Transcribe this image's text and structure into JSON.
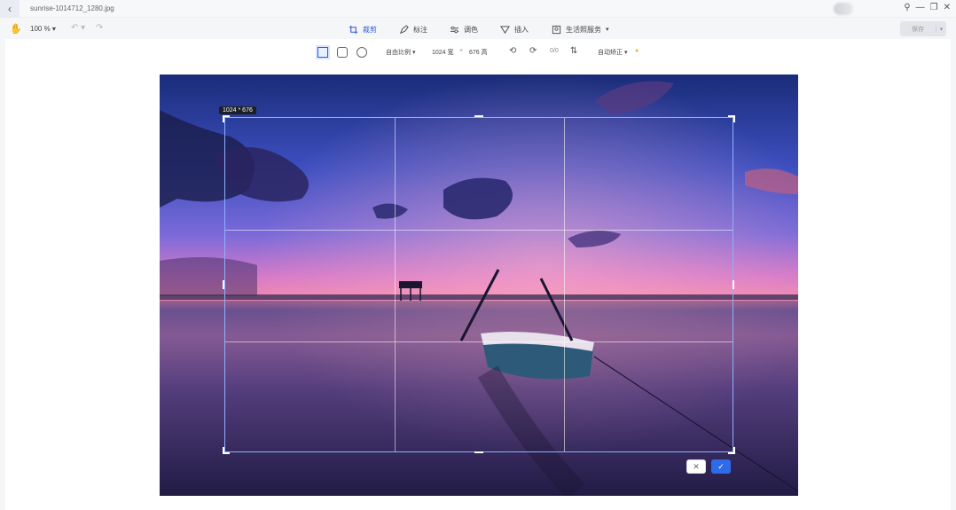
{
  "titlebar": {
    "back_icon": "chevron-left-icon",
    "filename": "sunrise-1014712_1280.jpg",
    "window_buttons": [
      "pin-icon",
      "minimize-icon",
      "restore-icon",
      "close-icon"
    ]
  },
  "toolbar": {
    "zoom": "100 %",
    "tabs": [
      {
        "label": "裁剪",
        "icon": "crop-icon",
        "active": true
      },
      {
        "label": "标注",
        "icon": "annotate-icon",
        "active": false
      },
      {
        "label": "调色",
        "icon": "adjust-icon",
        "active": false
      },
      {
        "label": "插入",
        "icon": "insert-icon",
        "active": false
      },
      {
        "label": "生活照服务",
        "icon": "photo-service-icon",
        "active": false
      }
    ],
    "save_label": "保存"
  },
  "crop_toolbar": {
    "ratio_label": "自由比例",
    "width_value": "1024",
    "width_unit": "宽",
    "times": "×",
    "height_value": "676",
    "height_unit": "高",
    "rotate_label": "0/0",
    "auto_label": "自动矫正"
  },
  "crop": {
    "size_tag": "1024 * 676",
    "cancel_icon": "close-icon",
    "confirm_icon": "check-icon"
  },
  "colors": {
    "accent": "#2f5bd8",
    "confirm": "#2f6be8"
  }
}
